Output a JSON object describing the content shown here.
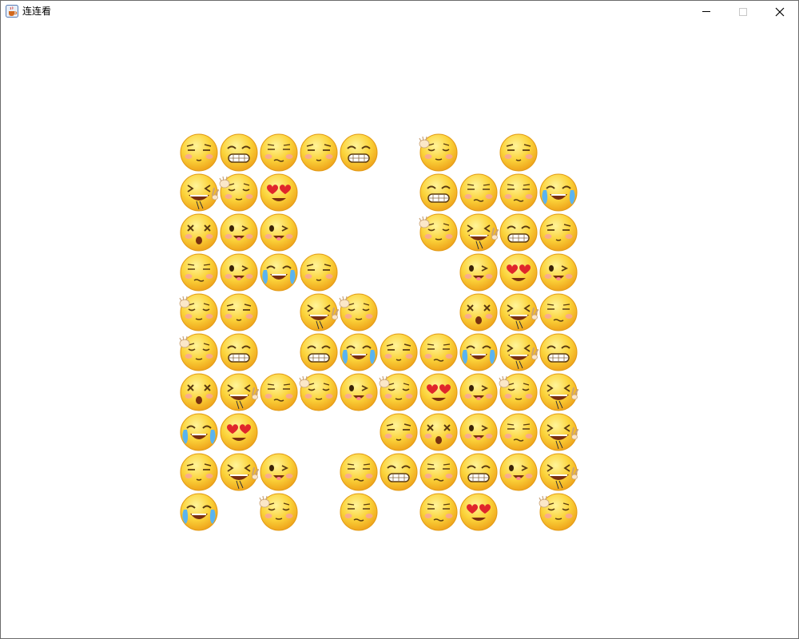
{
  "window": {
    "title": "连连看"
  },
  "icons": {
    "app": "java-cup-icon",
    "minimize": "minimize-icon",
    "maximize": "maximize-icon",
    "close": "close-icon"
  },
  "board": {
    "rows": 10,
    "cols": 10,
    "grid": [
      [
        "smug",
        "grin",
        "shy",
        "smug",
        "grin",
        null,
        "content-wave",
        null,
        "smug",
        null
      ],
      [
        "laugh-peace",
        "content-wave",
        "heart-eyes",
        null,
        null,
        null,
        "grin",
        "shy",
        "shy",
        "cry-laugh"
      ],
      [
        "dizzy",
        "wink",
        "wink",
        null,
        null,
        null,
        "content-wave",
        "laugh-peace",
        "grin",
        "smug"
      ],
      [
        "shy",
        "wink",
        "cry-laugh",
        "smug",
        null,
        null,
        null,
        "wink",
        "heart-eyes",
        "wink"
      ],
      [
        "content-wave",
        "smug",
        null,
        "laugh-peace",
        "content-wave",
        null,
        null,
        "dizzy",
        "laugh-peace",
        "shy"
      ],
      [
        "content-wave",
        "grin",
        null,
        "grin",
        "cry-laugh",
        "smug",
        "shy",
        "cry-laugh",
        "laugh-peace",
        "grin"
      ],
      [
        "dizzy",
        "laugh-peace",
        "shy",
        "content-wave",
        "wink",
        "content-wave",
        "heart-eyes",
        "wink",
        "content-wave",
        "laugh-peace"
      ],
      [
        "cry-laugh",
        "heart-eyes",
        null,
        null,
        null,
        "smug",
        "dizzy",
        "wink",
        "shy",
        "laugh-peace"
      ],
      [
        "smug",
        "laugh-peace",
        "wink",
        null,
        "shy",
        "grin",
        "shy",
        "grin",
        "wink",
        "laugh-peace"
      ],
      [
        "cry-laugh",
        null,
        "content-wave",
        null,
        "shy",
        null,
        "shy",
        "heart-eyes",
        null,
        "content-wave"
      ]
    ]
  }
}
